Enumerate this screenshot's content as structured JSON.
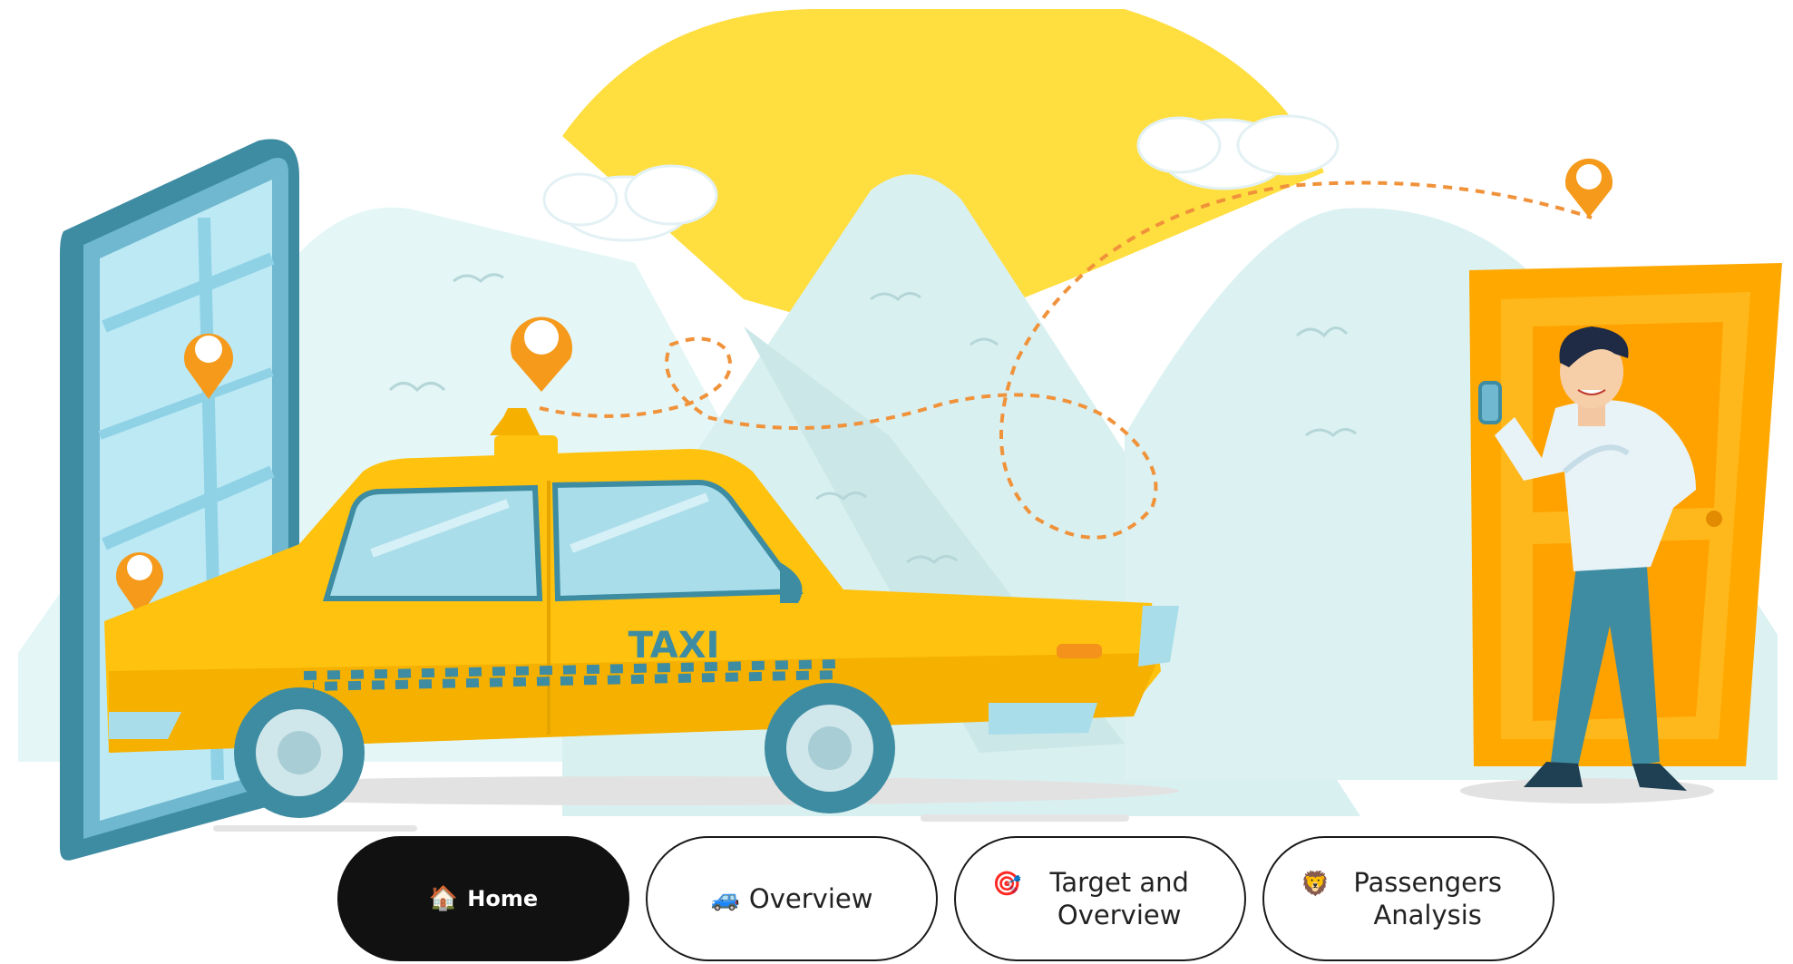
{
  "illustration": {
    "taxi_text": "TAXI",
    "colors": {
      "sun": "#FFDE40",
      "mountain": "#DDF2F2",
      "taxi": "#FFC20E",
      "taxi_dark": "#F0A500",
      "teal": "#3E8CA2",
      "glass": "#A9DDEA",
      "door": "#FFA800",
      "pin": "#F59A1B",
      "route": "#F0923A"
    }
  },
  "nav": {
    "items": [
      {
        "id": "home",
        "label": "Home",
        "icon": "house-icon",
        "glyph": "🏠",
        "active": true
      },
      {
        "id": "overview",
        "label": "Overview",
        "icon": "car-icon",
        "glyph": "🚙",
        "active": false
      },
      {
        "id": "target",
        "label": "Target and Overview",
        "icon": "target-icon",
        "glyph": "🎯",
        "active": false
      },
      {
        "id": "passengers",
        "label": "Passengers Analysis",
        "icon": "lion-icon",
        "glyph": "🦁",
        "active": false
      }
    ]
  }
}
